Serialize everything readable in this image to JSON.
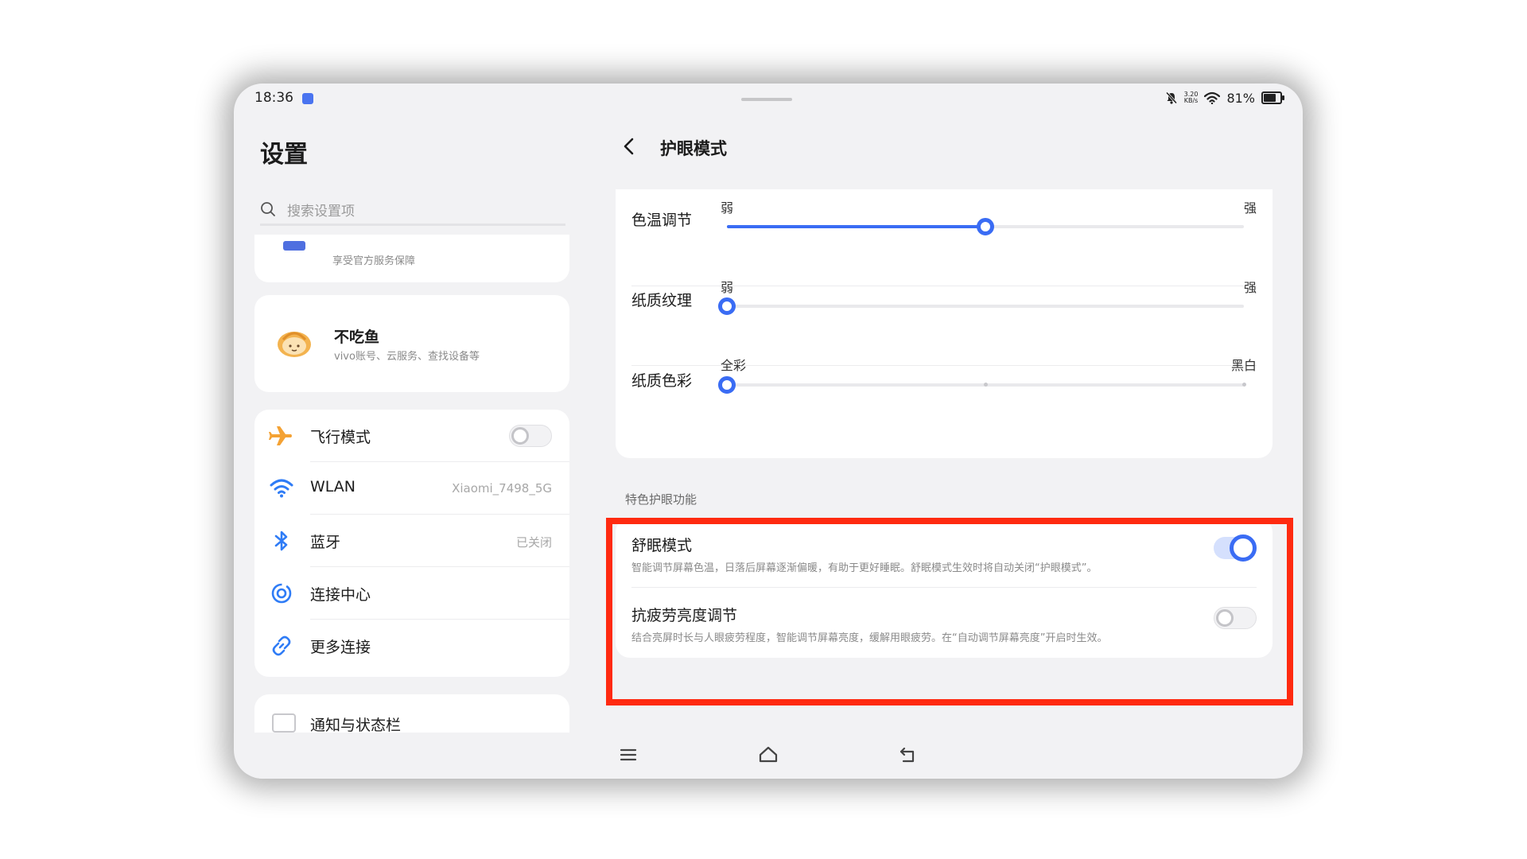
{
  "status_bar": {
    "time": "18:36",
    "net_speed_value": "3.20",
    "net_speed_unit": "KB/s",
    "battery": "81%",
    "icons": [
      "app-notification-icon",
      "mute-bell-icon",
      "wifi-icon",
      "battery-icon"
    ]
  },
  "left_panel": {
    "title": "设置",
    "search_placeholder": "搜索设置项",
    "service_card": {
      "subtitle": "享受官方服务保障"
    },
    "account": {
      "name": "不吃鱼",
      "subtitle": "vivo账号、云服务、查找设备等"
    },
    "connections": [
      {
        "icon": "airplane-icon",
        "label": "飞行模式",
        "control": "toggle",
        "on": false
      },
      {
        "icon": "wifi-icon",
        "label": "WLAN",
        "value": "Xiaomi_7498_5G"
      },
      {
        "icon": "bluetooth-icon",
        "label": "蓝牙",
        "value": "已关闭"
      },
      {
        "icon": "connection-center-icon",
        "label": "连接中心"
      },
      {
        "icon": "link-icon",
        "label": "更多连接"
      }
    ],
    "notifications": {
      "label": "通知与状态栏"
    }
  },
  "right_panel": {
    "title": "护眼模式",
    "sliders": [
      {
        "label": "色温调节",
        "low": "弱",
        "high": "强",
        "value": 0.5
      },
      {
        "label": "纸质纹理",
        "low": "弱",
        "high": "强",
        "value": 0.0
      },
      {
        "label": "纸质色彩",
        "low": "全彩",
        "high": "黑白",
        "value": 0.0,
        "steps": 3
      }
    ],
    "section_label": "特色护眼功能",
    "features": [
      {
        "label": "舒眠模式",
        "desc": "智能调节屏幕色温，日落后屏幕逐渐偏暖，有助于更好睡眠。舒眠模式生效时将自动关闭“护眼模式”。",
        "on": true
      },
      {
        "label": "抗疲劳亮度调节",
        "desc": "结合亮屏时长与人眼疲劳程度，智能调节屏幕亮度，缓解用眼疲劳。在“自动调节屏幕亮度”开启时生效。",
        "on": false
      }
    ]
  },
  "nav_bar": {
    "icons": [
      "menu-icon",
      "home-icon",
      "back-icon"
    ]
  },
  "colors": {
    "accent": "#3a6cf4",
    "highlight": "#ff2a10",
    "airplane": "#f4a234",
    "link": "#2f7cf6"
  }
}
